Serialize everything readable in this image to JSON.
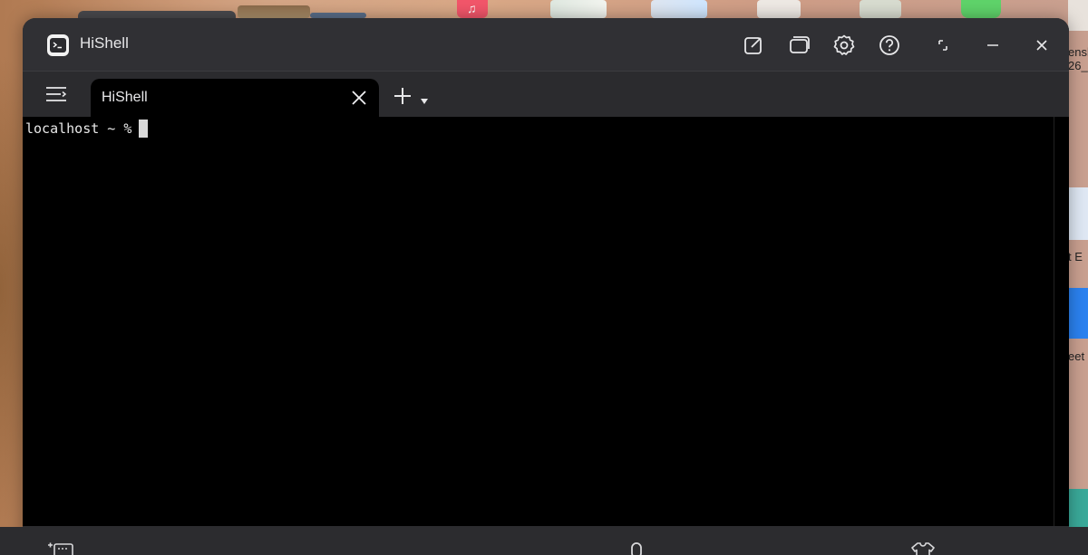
{
  "window": {
    "title": "HiShell",
    "icons": {
      "app": "terminal-app-icon",
      "new_window": "edit-square-icon",
      "windows": "window-stack-icon",
      "settings": "gear-icon",
      "help": "help-circle-icon",
      "restore": "restore-icon",
      "minimize": "minimize-icon",
      "close": "close-icon"
    }
  },
  "tabs": [
    {
      "label": "HiShell",
      "active": true
    }
  ],
  "terminal": {
    "prompt": "localhost ~ %",
    "cursor": "block"
  },
  "desktop": {
    "right_edge_text": [
      "ensh",
      "26_",
      "t E",
      "eet"
    ]
  },
  "bottom_bar": {
    "icons": [
      "keyboard-list-icon",
      "microphone-icon",
      "shirt-icon"
    ]
  },
  "colors": {
    "titlebar": "#303034",
    "terminal_bg": "#000000",
    "terminal_fg": "#e8e8e8"
  }
}
